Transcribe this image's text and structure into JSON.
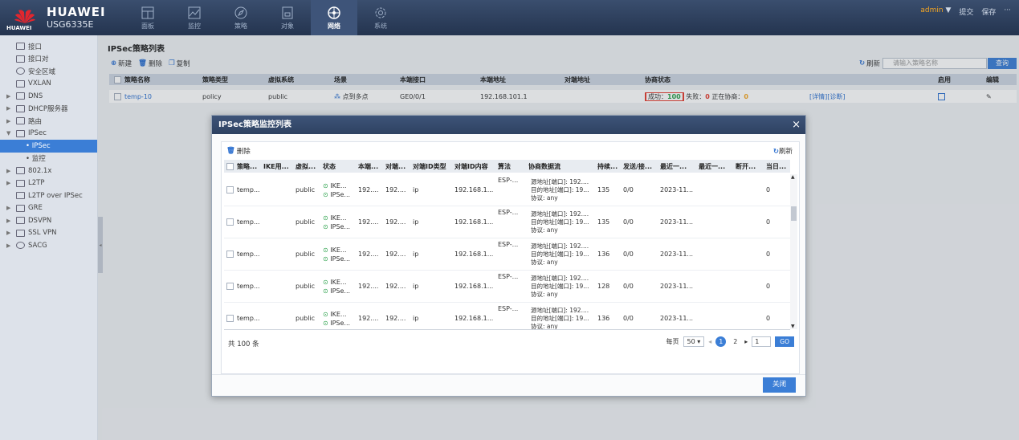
{
  "header": {
    "brand": "HUAWEI",
    "model": "USG6335E",
    "logo_small": "HUAWEI",
    "nav": [
      {
        "label": "面板",
        "icon": "dashboard-icon"
      },
      {
        "label": "监控",
        "icon": "monitor-icon"
      },
      {
        "label": "策略",
        "icon": "policy-icon"
      },
      {
        "label": "对象",
        "icon": "object-icon"
      },
      {
        "label": "网络",
        "icon": "network-icon"
      },
      {
        "label": "系统",
        "icon": "system-icon"
      }
    ],
    "user": "admin",
    "user_caret": "▼",
    "submit": "提交",
    "save": "保存",
    "more": "···"
  },
  "sidebar": {
    "items": [
      {
        "label": "接口"
      },
      {
        "label": "接口对"
      },
      {
        "label": "安全区域"
      },
      {
        "label": "VXLAN"
      },
      {
        "label": "DNS"
      },
      {
        "label": "DHCP服务器"
      },
      {
        "label": "路由"
      },
      {
        "label": "IPSec"
      },
      {
        "label": "IPSec"
      },
      {
        "label": "监控"
      },
      {
        "label": "802.1x"
      },
      {
        "label": "L2TP"
      },
      {
        "label": "L2TP over IPSec"
      },
      {
        "label": "GRE"
      },
      {
        "label": "DSVPN"
      },
      {
        "label": "SSL VPN"
      },
      {
        "label": "SACG"
      }
    ]
  },
  "main": {
    "title": "IPSec策略列表",
    "toolbar": {
      "new": "新建",
      "delete": "删除",
      "copy": "复制"
    },
    "refresh": "刷新",
    "search_placeholder": "请输入策略名称",
    "search_button": "查询",
    "columns": [
      "策略名称",
      "策略类型",
      "虚拟系统",
      "场景",
      "本端接口",
      "本端地址",
      "对端地址",
      "协商状态",
      "",
      "启用",
      "编辑"
    ],
    "row": {
      "name": "temp-10",
      "type": "policy",
      "vsys": "public",
      "scene": "点到多点",
      "local_if": "GE0/0/1",
      "local_addr": "192.168.101.1",
      "peer_addr": "",
      "success_label": "成功：",
      "success_count": "100",
      "fail_label": "失败：",
      "fail_count": "0",
      "nego_label": "正在协商：",
      "nego_count": "0",
      "detail": "[详情][诊断]"
    }
  },
  "modal": {
    "title": "IPSec策略监控列表",
    "close_x": "×",
    "delete": "删除",
    "refresh": "刷新",
    "columns": [
      "策略...",
      "IKE用...",
      "虚拟...",
      "状态",
      "本端...",
      "对端...",
      "对端ID类型",
      "对端ID内容",
      "算法",
      "协商数据流",
      "持续...",
      "发送/接...",
      "最近一...",
      "最近一...",
      "断开...",
      "当日..."
    ],
    "rows": [
      {
        "name": "temp...",
        "vsys": "public",
        "s1": "IKE...",
        "s2": "IPSe...",
        "local": "192....",
        "peer": "192....",
        "idtype": "ip",
        "idval": "192.168.1...",
        "alg": "ESP-...",
        "f1": "源地址[端口]: 192....",
        "f2": "目的地址[端口]: 19...",
        "f3": "协议: any",
        "dur": "135",
        "sr": "0/0",
        "recent": "2023-11...",
        "today": "0"
      },
      {
        "name": "temp...",
        "vsys": "public",
        "s1": "IKE...",
        "s2": "IPSe...",
        "local": "192....",
        "peer": "192....",
        "idtype": "ip",
        "idval": "192.168.1...",
        "alg": "ESP-...",
        "f1": "源地址[端口]: 192....",
        "f2": "目的地址[端口]: 19...",
        "f3": "协议: any",
        "dur": "135",
        "sr": "0/0",
        "recent": "2023-11...",
        "today": "0"
      },
      {
        "name": "temp...",
        "vsys": "public",
        "s1": "IKE...",
        "s2": "IPSe...",
        "local": "192....",
        "peer": "192....",
        "idtype": "ip",
        "idval": "192.168.1...",
        "alg": "ESP-...",
        "f1": "源地址[端口]: 192....",
        "f2": "目的地址[端口]: 19...",
        "f3": "协议: any",
        "dur": "136",
        "sr": "0/0",
        "recent": "2023-11...",
        "today": "0"
      },
      {
        "name": "temp...",
        "vsys": "public",
        "s1": "IKE...",
        "s2": "IPSe...",
        "local": "192....",
        "peer": "192....",
        "idtype": "ip",
        "idval": "192.168.1...",
        "alg": "ESP-...",
        "f1": "源地址[端口]: 192....",
        "f2": "目的地址[端口]: 19...",
        "f3": "协议: any",
        "dur": "128",
        "sr": "0/0",
        "recent": "2023-11...",
        "today": "0"
      },
      {
        "name": "temp...",
        "vsys": "public",
        "s1": "IKE...",
        "s2": "IPSe...",
        "local": "192....",
        "peer": "192....",
        "idtype": "ip",
        "idval": "192.168.1...",
        "alg": "ESP-...",
        "f1": "源地址[端口]: 192....",
        "f2": "目的地址[端口]: 19...",
        "f3": "协议: any",
        "dur": "136",
        "sr": "0/0",
        "recent": "2023-11...",
        "today": "0"
      }
    ],
    "total": "共 100 条",
    "per_page_label": "每页",
    "per_page": "50",
    "page1": "1",
    "page2": "2",
    "goto_value": "1",
    "go": "GO",
    "close_button": "关闭"
  }
}
